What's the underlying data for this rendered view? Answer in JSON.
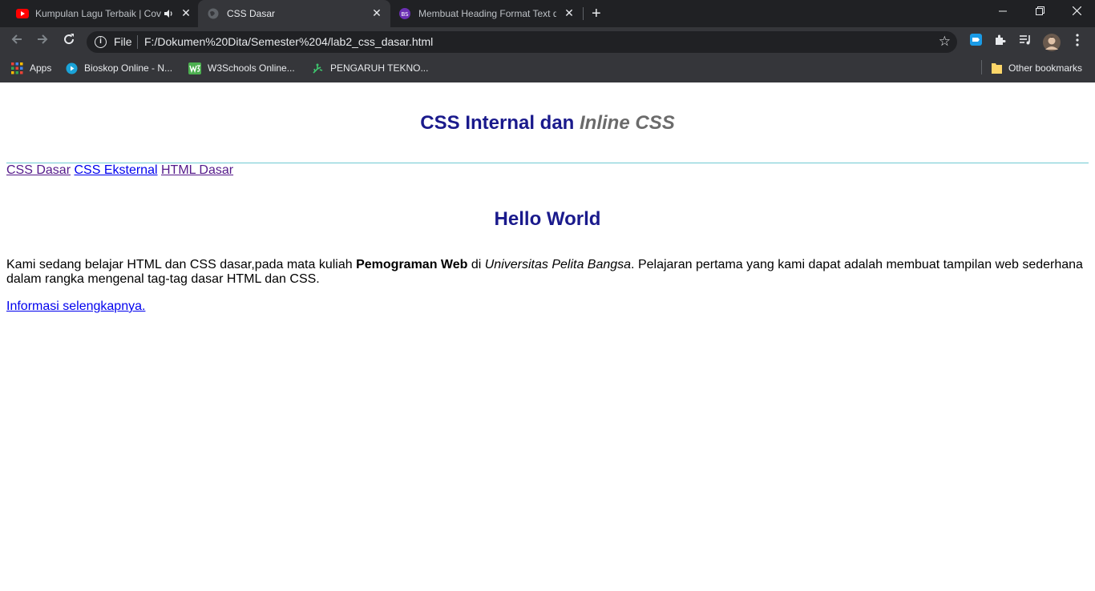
{
  "browser": {
    "tabs": [
      {
        "title": "Kumpulan Lagu Terbaik | Cov",
        "favicon": "youtube-icon",
        "audio": true,
        "active": false
      },
      {
        "title": "CSS Dasar",
        "favicon": "globe-icon",
        "active": true
      },
      {
        "title": "Membuat Heading Format Text d",
        "favicon": "site-icon",
        "active": false
      }
    ],
    "new_tab_label": "+",
    "omnibox": {
      "scheme_label": "File",
      "url": "F:/Dokumen%20Dita/Semester%204/lab2_css_dasar.html"
    },
    "bookmarks": [
      {
        "label": "Apps",
        "icon": "apps-grid-icon"
      },
      {
        "label": "Bioskop Online - N...",
        "icon": "play-icon"
      },
      {
        "label": "W3Schools Online...",
        "icon": "w3schools-icon"
      },
      {
        "label": "PENGARUH TEKNO...",
        "icon": "leaf-icon"
      }
    ],
    "other_bookmarks_label": "Other bookmarks",
    "colors": {
      "tabbar": "#202124",
      "toolbar": "#35363a",
      "text": "#e8eaed"
    }
  },
  "page": {
    "heading_main": "CSS Internal dan",
    "heading_inline": "Inline CSS",
    "nav_links": [
      "CSS Dasar",
      "CSS Eksternal",
      "HTML Dasar"
    ],
    "hello_heading": "Hello World",
    "paragraph": {
      "part1": "Kami sedang belajar HTML dan CSS dasar,pada mata kuliah ",
      "bold": "Pemograman Web",
      "part2": " di ",
      "italic": "Universitas Pelita Bangsa",
      "part3": ". Pelajaran pertama yang kami dapat adalah membuat tampilan web sederhana dalam rangka mengenal tag-tag dasar HTML dan CSS."
    },
    "more_link": "Informasi selengkapnya.",
    "colors": {
      "heading": "#1a1a8c",
      "inline": "#6b6b6b",
      "rule": "#6ecad2",
      "visited": "#551a8b",
      "link": "#0000ee"
    }
  }
}
